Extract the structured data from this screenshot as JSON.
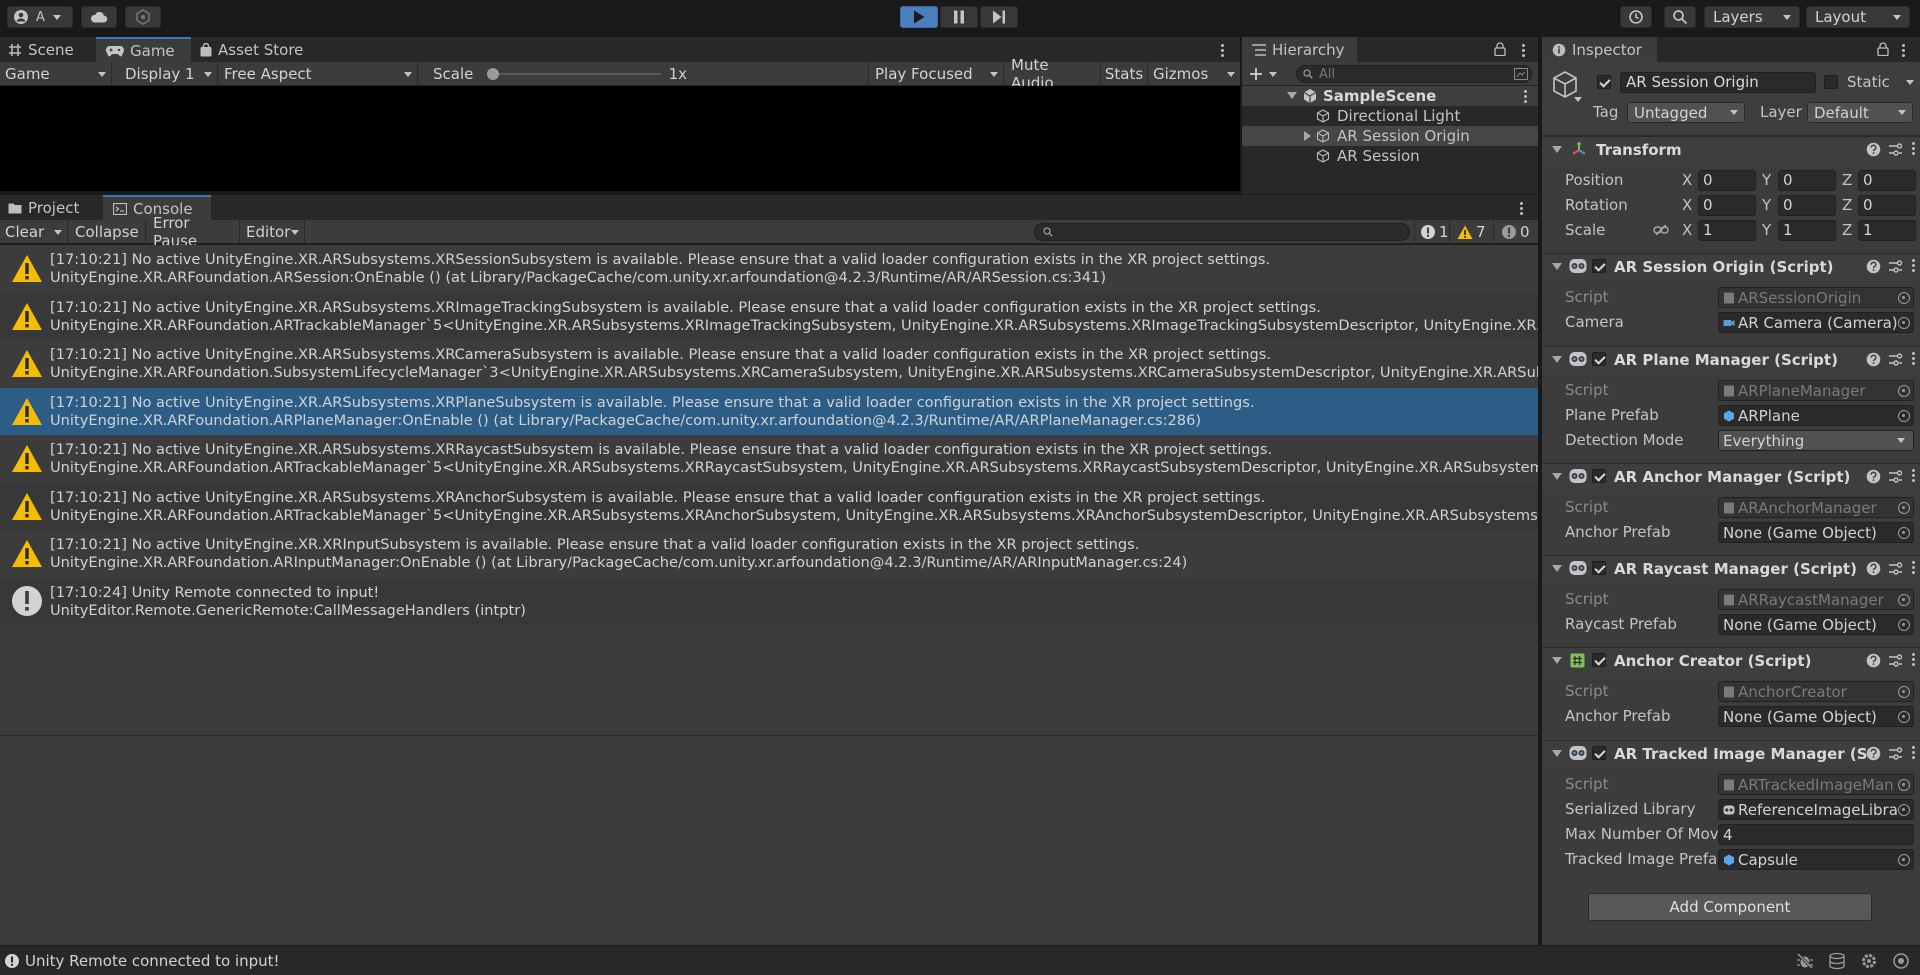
{
  "toolbar": {
    "account_label": "A",
    "layers_label": "Layers",
    "layout_label": "Layout"
  },
  "scene_panel": {
    "tabs": [
      {
        "label": "Scene"
      },
      {
        "label": "Game"
      },
      {
        "label": "Asset Store"
      }
    ],
    "game_toolbar": {
      "mode": "Game",
      "display": "Display 1",
      "aspect": "Free Aspect",
      "scale_label": "Scale",
      "scale_value": "1x",
      "scale_slider_level": 0,
      "play_focused": "Play Focused",
      "mute_audio": "Mute Audio",
      "stats": "Stats",
      "gizmos": "Gizmos"
    }
  },
  "hierarchy": {
    "title": "Hierarchy",
    "search_placeholder": "All",
    "scene_name": "SampleScene",
    "items": [
      {
        "label": "Directional Light"
      },
      {
        "label": "AR Session Origin"
      },
      {
        "label": "AR Session"
      }
    ]
  },
  "console_panel": {
    "tabs": [
      {
        "label": "Project"
      },
      {
        "label": "Console"
      }
    ],
    "toolbar": {
      "clear": "Clear",
      "collapse": "Collapse",
      "error_pause": "Error Pause",
      "editor": "Editor",
      "info_count": "1",
      "warn_count": "7",
      "error_count": "0"
    },
    "logs": [
      {
        "type": "warning",
        "line1": "[17:10:21] No active UnityEngine.XR.ARSubsystems.XRSessionSubsystem is available. Please ensure that a valid loader configuration exists in the XR project settings.",
        "line2": "UnityEngine.XR.ARFoundation.ARSession:OnEnable () (at Library/PackageCache/com.unity.xr.arfoundation@4.2.3/Runtime/AR/ARSession.cs:341)"
      },
      {
        "type": "warning",
        "line1": "[17:10:21] No active UnityEngine.XR.ARSubsystems.XRImageTrackingSubsystem is available. Please ensure that a valid loader configuration exists in the XR project settings.",
        "line2": "UnityEngine.XR.ARFoundation.ARTrackableManager`5<UnityEngine.XR.ARSubsystems.XRImageTrackingSubsystem, UnityEngine.XR.ARSubsystems.XRImageTrackingSubsystemDescriptor, UnityEngine.XR.A"
      },
      {
        "type": "warning",
        "line1": "[17:10:21] No active UnityEngine.XR.ARSubsystems.XRCameraSubsystem is available. Please ensure that a valid loader configuration exists in the XR project settings.",
        "line2": "UnityEngine.XR.ARFoundation.SubsystemLifecycleManager`3<UnityEngine.XR.ARSubsystems.XRCameraSubsystem, UnityEngine.XR.ARSubsystems.XRCameraSubsystemDescriptor, UnityEngine.XR.ARSubsys"
      },
      {
        "type": "warning",
        "line1": "[17:10:21] No active UnityEngine.XR.ARSubsystems.XRPlaneSubsystem is available. Please ensure that a valid loader configuration exists in the XR project settings.",
        "line2": "UnityEngine.XR.ARFoundation.ARPlaneManager:OnEnable () (at Library/PackageCache/com.unity.xr.arfoundation@4.2.3/Runtime/AR/ARPlaneManager.cs:286)",
        "selected": true
      },
      {
        "type": "warning",
        "line1": "[17:10:21] No active UnityEngine.XR.ARSubsystems.XRRaycastSubsystem is available. Please ensure that a valid loader configuration exists in the XR project settings.",
        "line2": "UnityEngine.XR.ARFoundation.ARTrackableManager`5<UnityEngine.XR.ARSubsystems.XRRaycastSubsystem, UnityEngine.XR.ARSubsystems.XRRaycastSubsystemDescriptor, UnityEngine.XR.ARSubsystems"
      },
      {
        "type": "warning",
        "line1": "[17:10:21] No active UnityEngine.XR.ARSubsystems.XRAnchorSubsystem is available. Please ensure that a valid loader configuration exists in the XR project settings.",
        "line2": "UnityEngine.XR.ARFoundation.ARTrackableManager`5<UnityEngine.XR.ARSubsystems.XRAnchorSubsystem, UnityEngine.XR.ARSubsystems.XRAnchorSubsystemDescriptor, UnityEngine.XR.ARSubsystems.XI"
      },
      {
        "type": "warning",
        "line1": "[17:10:21] No active UnityEngine.XR.XRInputSubsystem is available. Please ensure that a valid loader configuration exists in the XR project settings.",
        "line2": "UnityEngine.XR.ARFoundation.ARInputManager:OnEnable () (at Library/PackageCache/com.unity.xr.arfoundation@4.2.3/Runtime/AR/ARInputManager.cs:24)"
      },
      {
        "type": "info",
        "line1": "[17:10:24] Unity Remote connected to input!",
        "line2": "UnityEditor.Remote.GenericRemote:CallMessageHandlers (intptr)"
      }
    ]
  },
  "inspector": {
    "title": "Inspector",
    "object_name": "AR Session Origin",
    "static_label": "Static",
    "tag_label": "Tag",
    "tag_value": "Untagged",
    "layer_label": "Layer",
    "layer_value": "Default",
    "transform": {
      "title": "Transform",
      "position_label": "Position",
      "rotation_label": "Rotation",
      "scale_label": "Scale",
      "axis_x": "X",
      "axis_y": "Y",
      "axis_z": "Z",
      "position": [
        "0",
        "0",
        "0"
      ],
      "rotation": [
        "0",
        "0",
        "0"
      ],
      "scale": [
        "1",
        "1",
        "1"
      ]
    },
    "components": [
      {
        "title": "AR Session Origin (Script)",
        "script_label": "Script",
        "script_value": "ARSessionOrigin",
        "prop_label": "Camera",
        "prop_value": "AR Camera (Camera)"
      },
      {
        "title": "AR Plane Manager (Script)",
        "script_label": "Script",
        "script_value": "ARPlaneManager",
        "prop_label": "Plane Prefab",
        "prop_value": "ARPlane",
        "prop2_label": "Detection Mode",
        "prop2_value": "Everything"
      },
      {
        "title": "AR Anchor Manager (Script)",
        "script_label": "Script",
        "script_value": "ARAnchorManager",
        "prop_label": "Anchor Prefab",
        "prop_value": "None (Game Object)"
      },
      {
        "title": "AR Raycast Manager (Script)",
        "script_label": "Script",
        "script_value": "ARRaycastManager",
        "prop_label": "Raycast Prefab",
        "prop_value": "None (Game Object)"
      },
      {
        "title": "Anchor Creator (Script)",
        "script_label": "Script",
        "script_value": "AnchorCreator",
        "prop_label": "Anchor Prefab",
        "prop_value": "None (Game Object)"
      },
      {
        "title": "AR Tracked Image Manager (S",
        "script_label": "Script",
        "script_value": "ARTrackedImageMan",
        "prop_label": "Serialized Library",
        "prop_value": "ReferenceImageLibra",
        "prop2_label": "Max Number Of Mov",
        "prop2_value": "4",
        "prop3_label": "Tracked Image Prefa",
        "prop3_value": "Capsule"
      }
    ],
    "add_component": "Add Component"
  },
  "status_bar": {
    "message": "Unity Remote connected to input!"
  },
  "colors": {
    "selection": "#2c5d87",
    "warning": "#f4bc02",
    "play_accent": "#4c7fbe"
  }
}
